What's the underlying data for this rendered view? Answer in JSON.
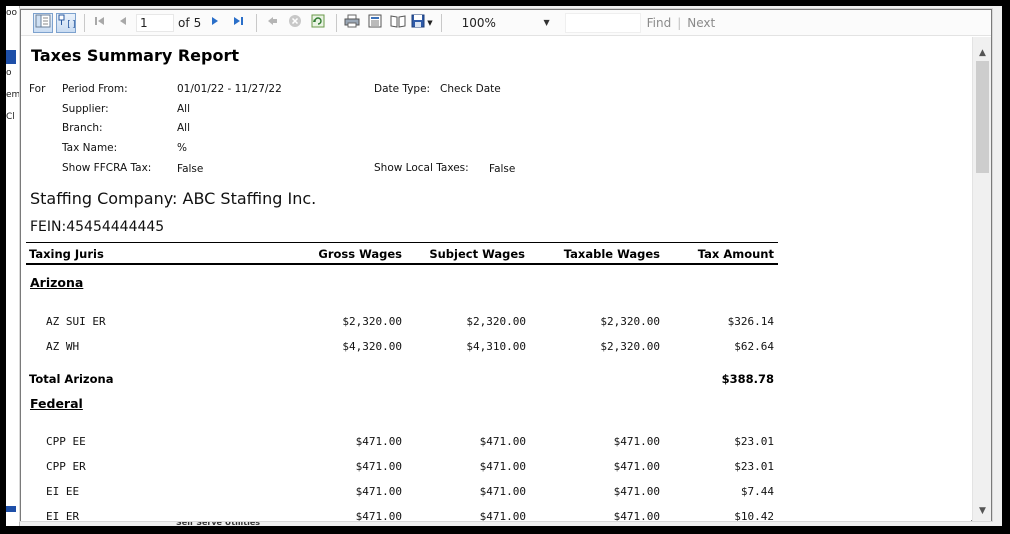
{
  "background": {
    "side_fragments": [
      "oo",
      "o",
      "em",
      "Cl"
    ],
    "bottom_fragment": "Self Serve Utilities"
  },
  "toolbar": {
    "current_page": "1",
    "of_label": "of",
    "total_pages": "5",
    "zoom": "100%",
    "find_label": "Find",
    "separator": "|",
    "next_label": "Next"
  },
  "report": {
    "title": "Taxes Summary Report",
    "for_label": "For",
    "params": {
      "period_from_label": "Period From:",
      "period_from_value": "01/01/22 - 11/27/22",
      "date_type_label": "Date Type:",
      "date_type_value": "Check Date",
      "supplier_label": "Supplier:",
      "supplier_value": "All",
      "branch_label": "Branch:",
      "branch_value": "All",
      "tax_name_label": "Tax Name:",
      "tax_name_value": "%",
      "show_ffcra_label": "Show FFCRA Tax:",
      "show_ffcra_value": "False",
      "show_local_label": "Show Local Taxes:",
      "show_local_value": "False"
    },
    "company": "Staffing Company: ABC Staffing Inc.",
    "fein": "FEIN:45454444445",
    "columns": [
      "Taxing Juris",
      "Gross Wages",
      "Subject Wages",
      "Taxable Wages",
      "Tax Amount"
    ],
    "groups": [
      {
        "name": "Arizona",
        "rows": [
          [
            "AZ SUI ER",
            "$2,320.00",
            "$2,320.00",
            "$2,320.00",
            "$326.14"
          ],
          [
            "AZ WH",
            "$4,320.00",
            "$4,310.00",
            "$2,320.00",
            "$62.64"
          ]
        ],
        "total_label": "Total Arizona",
        "total_amount": "$388.78"
      },
      {
        "name": "Federal",
        "rows": [
          [
            "CPP EE",
            "$471.00",
            "$471.00",
            "$471.00",
            "$23.01"
          ],
          [
            "CPP ER",
            "$471.00",
            "$471.00",
            "$471.00",
            "$23.01"
          ],
          [
            "EI EE",
            "$471.00",
            "$471.00",
            "$471.00",
            "$7.44"
          ],
          [
            "EI ER",
            "$471.00",
            "$471.00",
            "$471.00",
            "$10.42"
          ]
        ]
      }
    ]
  }
}
